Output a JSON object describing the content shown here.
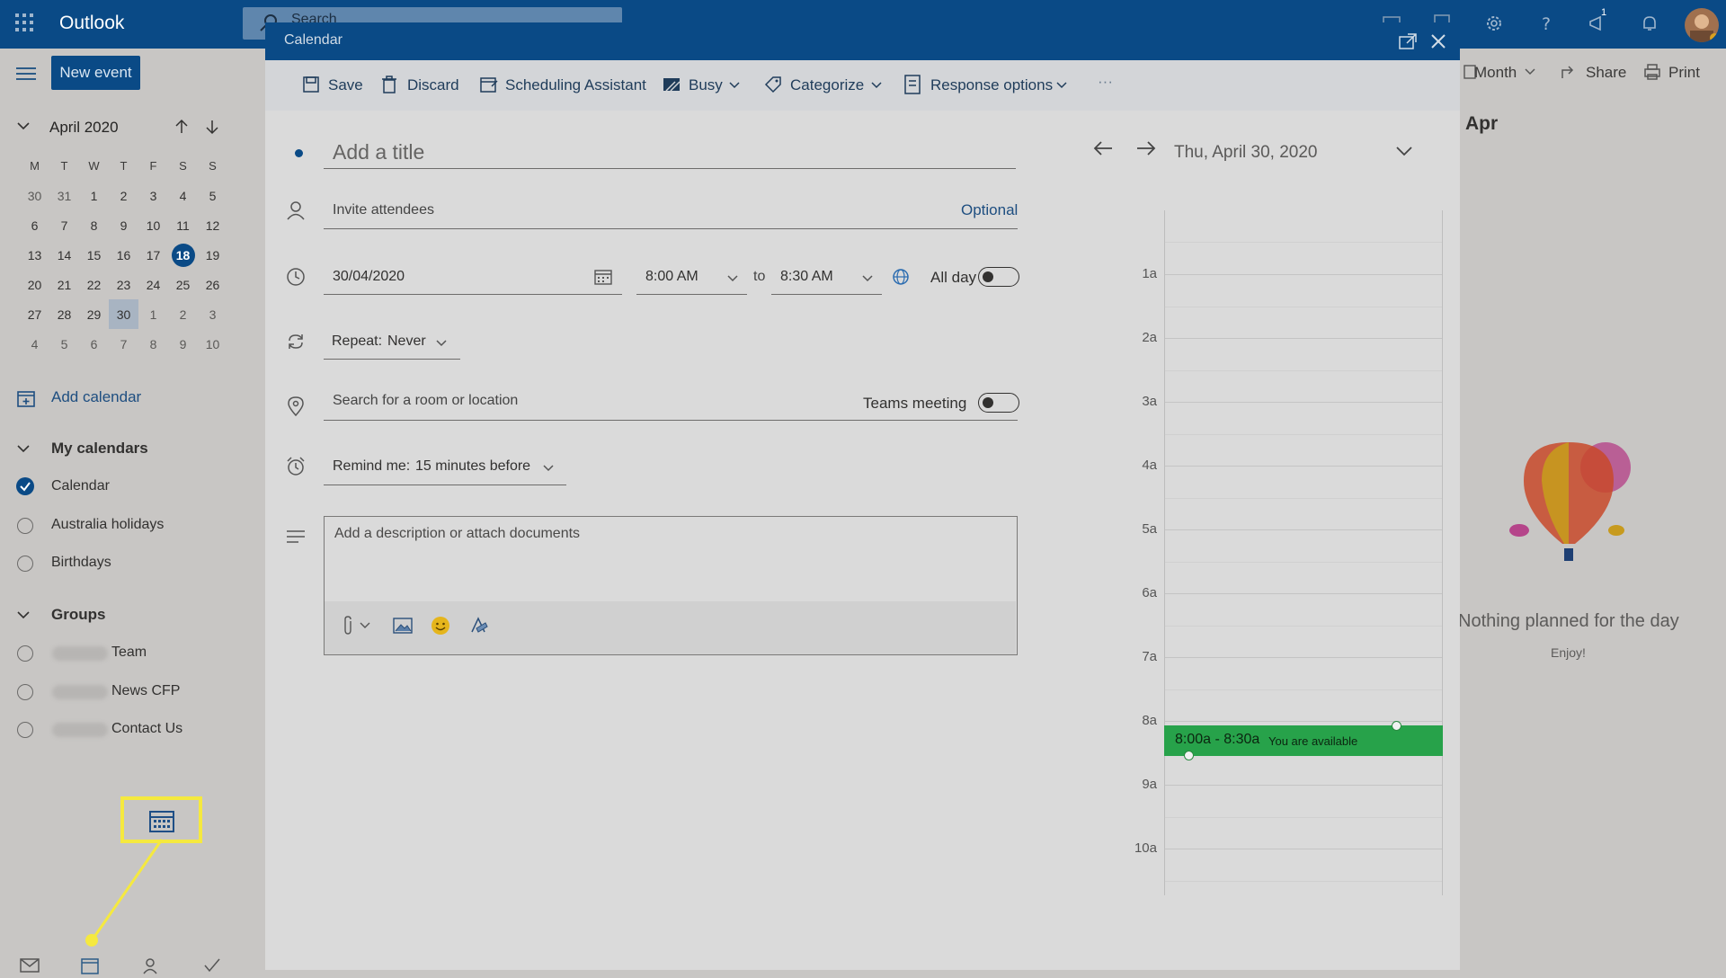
{
  "app": {
    "name": "Outlook",
    "search_placeholder": "Search",
    "notification_count": "1"
  },
  "left": {
    "new_event_label": "New event",
    "month_label": "April 2020",
    "weekdays": [
      "M",
      "T",
      "W",
      "T",
      "F",
      "S",
      "S"
    ],
    "weeks": [
      [
        "30",
        "31",
        "1",
        "2",
        "3",
        "4",
        "5"
      ],
      [
        "6",
        "7",
        "8",
        "9",
        "10",
        "11",
        "12"
      ],
      [
        "13",
        "14",
        "15",
        "16",
        "17",
        "18",
        "19"
      ],
      [
        "20",
        "21",
        "22",
        "23",
        "24",
        "25",
        "26"
      ],
      [
        "27",
        "28",
        "29",
        "30",
        "1",
        "2",
        "3"
      ],
      [
        "4",
        "5",
        "6",
        "7",
        "8",
        "9",
        "10"
      ]
    ],
    "today": "18",
    "selected": "30",
    "add_calendar": "Add calendar",
    "my_calendars_header": "My calendars",
    "my_calendars": [
      {
        "label": "Calendar",
        "checked": true
      },
      {
        "label": "Australia holidays",
        "checked": false
      },
      {
        "label": "Birthdays",
        "checked": false
      }
    ],
    "groups_header": "Groups",
    "groups": [
      {
        "label": "Team"
      },
      {
        "label": "News CFP"
      },
      {
        "label": "Contact Us"
      }
    ]
  },
  "right": {
    "view_label": "Month",
    "share_label": "Share",
    "print_label": "Print",
    "date_fragment": "Apr",
    "empty_title": "Nothing planned for the day",
    "empty_sub": "Enjoy!"
  },
  "dialog": {
    "title": "Calendar",
    "toolbar": {
      "save": "Save",
      "discard": "Discard",
      "scheduling": "Scheduling Assistant",
      "busy": "Busy",
      "categorize": "Categorize",
      "response": "Response options",
      "more": "···"
    },
    "title_placeholder": "Add a title",
    "attendees_placeholder": "Invite attendees",
    "optional_label": "Optional",
    "date_value": "30/04/2020",
    "start_time": "8:00 AM",
    "to_label": "to",
    "end_time": "8:30 AM",
    "all_day_label": "All day",
    "repeat_label": "Repeat:",
    "repeat_value": "Never",
    "location_placeholder": "Search for a room or location",
    "teams_label": "Teams meeting",
    "remind_label": "Remind me:",
    "remind_value": "15 minutes before",
    "description_placeholder": "Add a description or attach documents"
  },
  "day_view": {
    "date": "Thu, April 30, 2020",
    "hours": [
      "1a",
      "2a",
      "3a",
      "4a",
      "5a",
      "6a",
      "7a",
      "8a",
      "9a",
      "10a"
    ],
    "event_time": "8:00a - 8:30a",
    "event_status": "You are available"
  },
  "colors": {
    "brand": "#0a4a86",
    "event_green": "#27a24a",
    "highlight": "#f5e93f"
  }
}
